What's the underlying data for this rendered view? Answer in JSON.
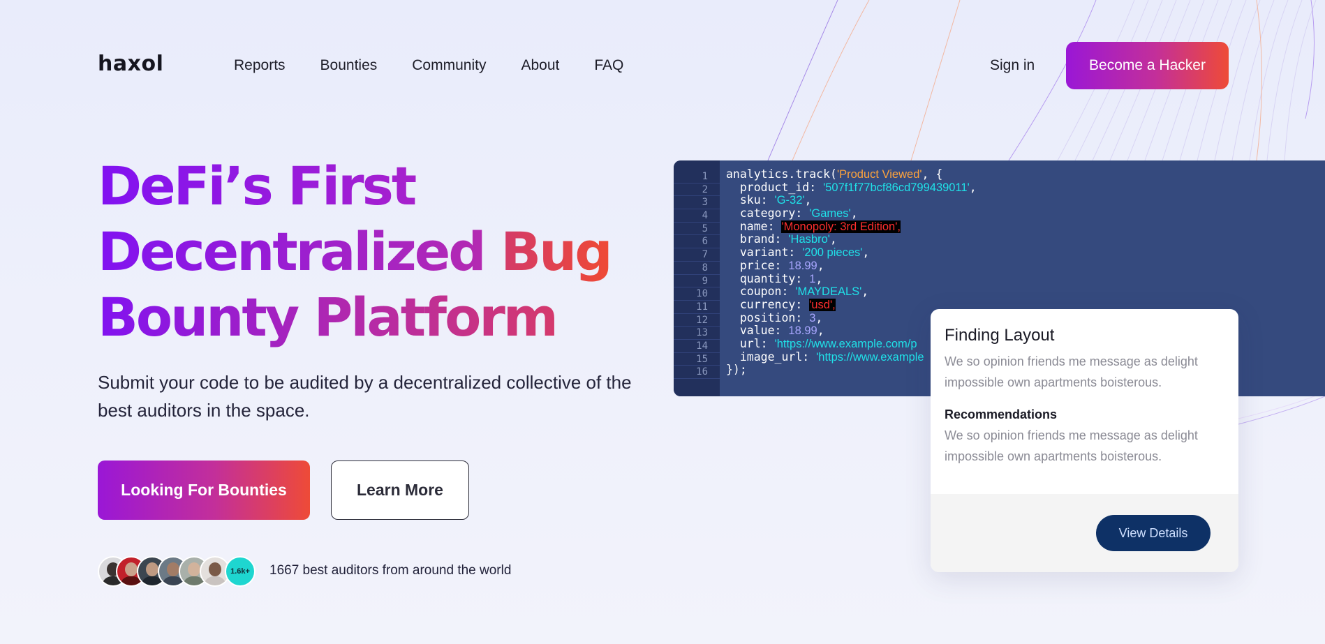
{
  "header": {
    "logo": "haxol",
    "nav": [
      "Reports",
      "Bounties",
      "Community",
      "About",
      "FAQ"
    ],
    "sign_in": "Sign in",
    "cta": "Become a Hacker"
  },
  "hero": {
    "headline_line1": "DeFi’s First",
    "headline_line2a": "Decentralized",
    "headline_line2b": "Bug",
    "headline_line3": "Bounty Platform",
    "subtitle": "Submit your code to be audited by a decentralized collective of the best auditors in the space.",
    "primary_button": "Looking For Bounties",
    "secondary_button": "Learn More",
    "auditor_badge": "1.6k+",
    "auditors_text": "1667 best auditors from around the world"
  },
  "code_panel": {
    "line_numbers": [
      "1",
      "2",
      "3",
      "4",
      "5",
      "6",
      "7",
      "8",
      "9",
      "10",
      "11",
      "12",
      "13",
      "14",
      "15",
      "16"
    ],
    "l1": {
      "pre": "analytics.track(",
      "event": "'Product Viewed'",
      "post": ", {"
    },
    "l2": {
      "key": "  product_id: ",
      "val": "'507f1f77bcf86cd799439011'",
      "post": ","
    },
    "l3": {
      "key": "  sku: ",
      "val": "'G-32'",
      "post": ","
    },
    "l4": {
      "key": "  category: ",
      "val": "'Games'",
      "post": ","
    },
    "l5": {
      "key": "  name: ",
      "val": "'Monopoly: 3rd Edition',"
    },
    "l6": {
      "key": "  brand: ",
      "val": "'Hasbro'",
      "post": ","
    },
    "l7": {
      "key": "  variant: ",
      "val": "'200 pieces'",
      "post": ","
    },
    "l8": {
      "key": "  price: ",
      "val": "18.99",
      "post": ","
    },
    "l9": {
      "key": "  quantity: ",
      "val": "1",
      "post": ","
    },
    "l10": {
      "key": "  coupon: ",
      "val": "'MAYDEALS'",
      "post": ","
    },
    "l11": {
      "key": "  currency: ",
      "val": "'usd',"
    },
    "l12": {
      "key": "  position: ",
      "val": "3",
      "post": ","
    },
    "l13": {
      "key": "  value: ",
      "val": "18.99",
      "post": ","
    },
    "l14": {
      "key": "  url: ",
      "val": "'https://www.example.com/p"
    },
    "l15": {
      "key": "  image_url: ",
      "val": "'https://www.example"
    },
    "l16": {
      "pre": "});"
    }
  },
  "card": {
    "title": "Finding Layout",
    "text1": "We so opinion friends me message as delight impossible own apartments boisterous.",
    "subtitle": "Recommendations",
    "text2": "We so opinion friends me message as delight impossible own apartments boisterous.",
    "button": "View Details"
  },
  "colors": {
    "brand_gradient_start": "#9a17d6",
    "brand_gradient_end": "#ee4b37",
    "code_bg": "#354a7e",
    "code_string": "#20e1e8",
    "code_number": "#a9a7ff",
    "view_button": "#0e3166"
  }
}
